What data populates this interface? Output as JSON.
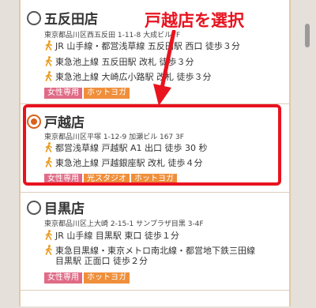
{
  "stores": [
    {
      "name": "五反田店",
      "address": "東京都品川区西五反田 1-11-8 大成ビル7F",
      "access": [
        {
          "text": "JR 山手線・都営浅草線 五反田駅 西口 徒歩３分"
        },
        {
          "text": "東急池上線 五反田駅 改札 徒歩３分"
        },
        {
          "text": "東急池上線 大崎広小路駅 改札 徒歩３分"
        }
      ],
      "tags": [
        "女性専用",
        "ホットヨガ"
      ],
      "selected": false
    },
    {
      "name": "戸越店",
      "address": "東京都品川区平塚 1-12-9 加瀬ビル 167 3F",
      "access": [
        {
          "text": "都営浅草線 戸越駅 A1 出口 徒歩 30 秒"
        },
        {
          "text": "東急池上線 戸越銀座駅 改札 徒歩４分"
        }
      ],
      "tags": [
        "女性専用",
        "光スタジオ",
        "ホットヨガ"
      ],
      "selected": true
    },
    {
      "name": "目黒店",
      "address": "東京都品川区上大崎 2-15-1 サンプラザ目黒 3-4F",
      "access": [
        {
          "text": "JR 山手線 目黒駅 東口 徒歩１分"
        },
        {
          "text": "東急目黒線・東京メトロ南北線・都営地下鉄三田線",
          "cont": "目黒駅 正面口 徒歩２分"
        }
      ],
      "tags": [
        "女性専用",
        "ホットヨガ"
      ],
      "selected": false
    }
  ],
  "annotation": "戸越店を選択",
  "colors": {
    "accent": "#d9621c",
    "highlight": "#e8131f",
    "tag_pink": "#e06b86",
    "tag_orange": "#ef8f3b"
  }
}
